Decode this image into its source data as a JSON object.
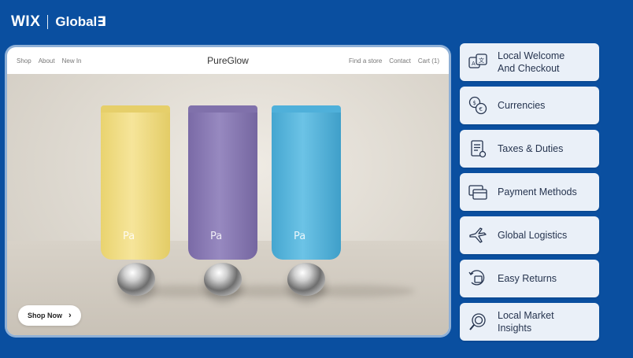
{
  "brand": {
    "left": "WIX",
    "right": "Global∃"
  },
  "store": {
    "nav_left": [
      "Shop",
      "About",
      "New In"
    ],
    "name": "PureGlow",
    "nav_right": [
      "Find a store",
      "Contact",
      "Cart (1)"
    ],
    "shop_button": "Shop Now",
    "product_logo": "Pa"
  },
  "features": [
    {
      "label_1": "Local Welcome",
      "label_2": "And Checkout",
      "icon": "translate-icon"
    },
    {
      "label_1": "Currencies",
      "label_2": "",
      "icon": "currency-exchange-icon"
    },
    {
      "label_1": "Taxes & Duties",
      "label_2": "",
      "icon": "tax-document-icon"
    },
    {
      "label_1": "Payment Methods",
      "label_2": "",
      "icon": "credit-card-icon"
    },
    {
      "label_1": "Global Logistics",
      "label_2": "",
      "icon": "airplane-icon"
    },
    {
      "label_1": "Easy Returns",
      "label_2": "",
      "icon": "return-box-icon"
    },
    {
      "label_1": "Local Market",
      "label_2": "Insights",
      "icon": "magnifier-globe-icon"
    }
  ],
  "colors": {
    "background": "#0a4fa0",
    "card": "#eaf0f8",
    "tube_yellow": "#f3e08a",
    "tube_purple": "#8a7bb5",
    "tube_blue": "#5ab6dc"
  }
}
